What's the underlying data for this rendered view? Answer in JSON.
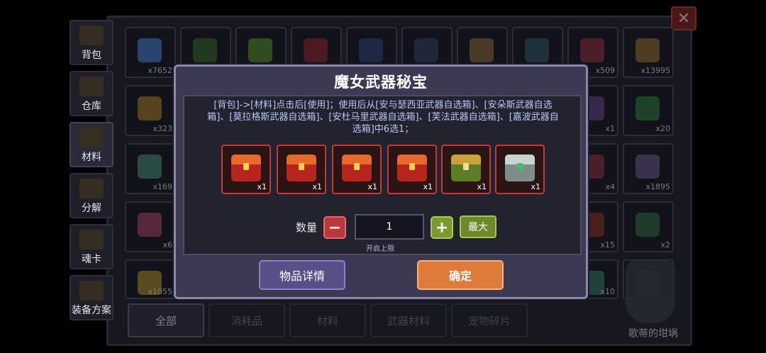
{
  "side_tabs": [
    {
      "label": "背包",
      "icon": "chest-icon"
    },
    {
      "label": "仓库",
      "icon": "warehouse-icon"
    },
    {
      "label": "材料",
      "icon": "material-icon"
    },
    {
      "label": "分解",
      "icon": "decompose-icon"
    },
    {
      "label": "魂卡",
      "icon": "soul-card-icon"
    },
    {
      "label": "装备方案",
      "icon": "equipment-plan-icon"
    }
  ],
  "active_side_tab": "材料",
  "grid_quantities": {
    "row1_first": "x7652",
    "row1_ninth": "x509",
    "row1_tenth": "x13995",
    "row2_first": "x323",
    "row2_ninth": "x1",
    "row2_tenth": "x20",
    "row3_first": "x169",
    "row3_ninth": "x4",
    "row3_tenth": "x1895",
    "row4_first": "x6",
    "row4_ninth": "x15",
    "row4_tenth": "x2",
    "row5_first": "x1055",
    "row5_ninth": "x10"
  },
  "bottom_tabs": [
    "全部",
    "消耗品",
    "材料",
    "武器材料",
    "宠物碎片"
  ],
  "active_bottom_tab": "全部",
  "cauldron_label": "歌蒂的坩埚",
  "modal": {
    "title": "魔女武器秘宝",
    "description": "[背包]->[材料]点击后[使用]；使用后从[安与瑟西亚武器自选箱]、[安朵斯武器自选箱]、[莫拉格斯武器自选箱]、[安杜马里武器自选箱]、[芙法武器自选箱]、[嘉波武器自选箱]中6选1；",
    "rewards": [
      {
        "icon": "red-weapon-chest-icon",
        "qty": "x1",
        "color": "#d8372c"
      },
      {
        "icon": "red-weapon-chest-icon",
        "qty": "x1",
        "color": "#d8372c"
      },
      {
        "icon": "red-weapon-chest-icon",
        "qty": "x1",
        "color": "#d8372c"
      },
      {
        "icon": "red-weapon-chest-icon",
        "qty": "x1",
        "color": "#d8372c"
      },
      {
        "icon": "green-weapon-chest-icon",
        "qty": "x1",
        "color": "#7fae3a"
      },
      {
        "icon": "silver-weapon-chest-icon",
        "qty": "x1",
        "color": "#b9c6c4"
      }
    ],
    "quantity_label": "数量",
    "quantity_value": "1",
    "max_label": "最大",
    "limit_text": "开启上限",
    "details_label": "物品详情",
    "confirm_label": "确定"
  }
}
